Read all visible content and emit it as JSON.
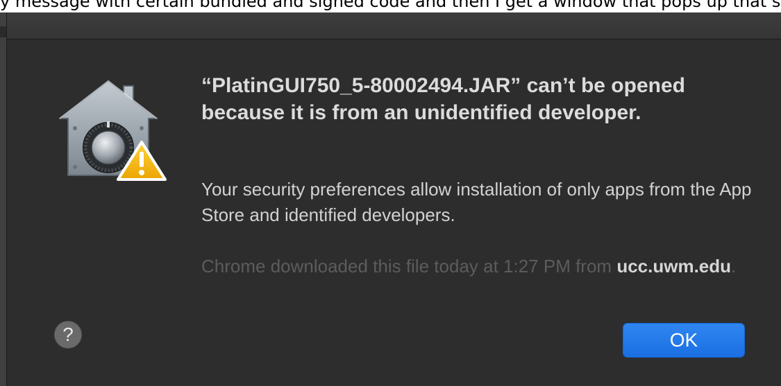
{
  "caption": "y message with certain bundled and signed code and then I get a window that pops up that says:",
  "dialog": {
    "title": "“PlatinGUI750_5-80002494.JAR” can’t be opened because it is from an unidentified developer.",
    "info": "Your security preferences allow installation of only apps from the App Store and identified developers.",
    "source_prefix": "Chrome downloaded this file today at 1:27 PM from",
    "source_domain": "ucc.uwm.edu",
    "source_suffix": ".",
    "help_label": "?",
    "ok_label": "OK",
    "icon": "gatekeeper-security-icon",
    "badge_icon": "warning-triangle-icon"
  },
  "colors": {
    "background": "#2d2d2d",
    "title_text": "#dcdcdc",
    "body_text": "#d2d2d2",
    "dim_text": "#5c5c5c",
    "accent": "#1b6fe2",
    "warning": "#f2b705"
  }
}
